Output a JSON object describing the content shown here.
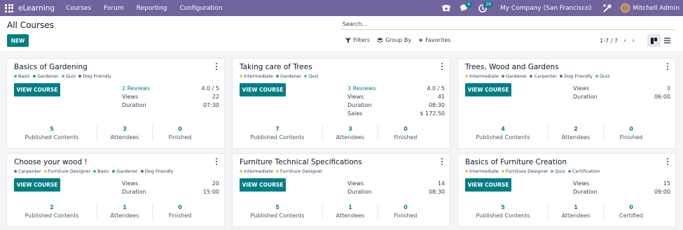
{
  "navbar": {
    "brand": "eLearning",
    "menu": [
      "Courses",
      "Forum",
      "Reporting",
      "Configuration"
    ],
    "messages_badge": "6",
    "activities_badge": "39",
    "company": "My Company (San Francisco)",
    "user": "Mitchell Admin",
    "colors": {
      "bar": "#71639e",
      "badge": "#017e84"
    }
  },
  "control": {
    "title": "All Courses",
    "new_label": "NEW",
    "search_placeholder": "Search...",
    "filters_label": "Filters",
    "groupby_label": "Group By",
    "favorites_label": "Favorites",
    "pager": "1-7 / 7"
  },
  "accent_color": "#017e84",
  "cards": [
    {
      "title": "Basics of Gardening",
      "tags": [
        {
          "name": "Basic",
          "color": "#3ebf6b"
        },
        {
          "name": "Gardener",
          "color": "#2e9e74"
        },
        {
          "name": "Quiz",
          "color": "#5fb7c8"
        },
        {
          "name": "Dog Friendly",
          "color": "#6f5b99"
        }
      ],
      "button": "VIEW COURSE",
      "stats": [
        {
          "label": "2 Reviews",
          "value": "4.0 / 5",
          "link": true
        },
        {
          "label": "Views",
          "value": "22"
        },
        {
          "label": "Duration",
          "value": "07:30"
        }
      ],
      "bottom": [
        {
          "num": "5",
          "label": "Published Contents"
        },
        {
          "num": "3",
          "label": "Attendees"
        },
        {
          "num": "0",
          "label": "Finished"
        }
      ]
    },
    {
      "title": "Taking care of Trees",
      "tags": [
        {
          "name": "Intermediate",
          "color": "#f0c42e"
        },
        {
          "name": "Gardener",
          "color": "#2e9e74"
        },
        {
          "name": "Quiz",
          "color": "#5fb7c8"
        }
      ],
      "button": "VIEW COURSE",
      "stats": [
        {
          "label": "3 Reviews",
          "value": "4.0 / 5",
          "link": true
        },
        {
          "label": "Views",
          "value": "41"
        },
        {
          "label": "Duration",
          "value": "08:30"
        },
        {
          "label": "Sales",
          "value": "$ 172.50"
        }
      ],
      "bottom": [
        {
          "num": "7",
          "label": "Published Contents"
        },
        {
          "num": "3",
          "label": "Attendees"
        },
        {
          "num": "0",
          "label": "Finished"
        }
      ]
    },
    {
      "title": "Trees, Wood and Gardens",
      "tags": [
        {
          "name": "Intermediate",
          "color": "#f0c42e"
        },
        {
          "name": "Gardener",
          "color": "#2e9e74"
        },
        {
          "name": "Carpenter",
          "color": "#8a62a8"
        },
        {
          "name": "Dog Friendly",
          "color": "#6f5b99"
        },
        {
          "name": "Quiz",
          "color": "#5fb7c8"
        }
      ],
      "button": "VIEW COURSE",
      "stats": [
        {
          "label": "Views",
          "value": "3"
        },
        {
          "label": "Duration",
          "value": "06:00"
        }
      ],
      "bottom": [
        {
          "num": "4",
          "label": "Published Contents"
        },
        {
          "num": "2",
          "label": "Attendees"
        },
        {
          "num": "0",
          "label": "Finished"
        }
      ]
    },
    {
      "title": "Choose your wood !",
      "tags": [
        {
          "name": "Carpenter",
          "color": "#8a62a8"
        },
        {
          "name": "Furniture Designer",
          "color": "#f0c42e"
        },
        {
          "name": "Basic",
          "color": "#3ebf6b"
        },
        {
          "name": "Gardener",
          "color": "#2e9e74"
        },
        {
          "name": "Dog Friendly",
          "color": "#6f5b99"
        }
      ],
      "button": "VIEW COURSE",
      "stats": [
        {
          "label": "Views",
          "value": "20"
        },
        {
          "label": "Duration",
          "value": "15:00"
        }
      ],
      "bottom": [
        {
          "num": "2",
          "label": "Published Contents"
        },
        {
          "num": "1",
          "label": "Attendees"
        },
        {
          "num": "0",
          "label": "Finished"
        }
      ]
    },
    {
      "title": "Furniture Technical Specifications",
      "tags": [
        {
          "name": "Intermediate",
          "color": "#f0c42e"
        },
        {
          "name": "Furniture Designer",
          "color": "#f0c42e"
        }
      ],
      "button": "VIEW COURSE",
      "stats": [
        {
          "label": "Views",
          "value": "14"
        },
        {
          "label": "Duration",
          "value": "08:30"
        }
      ],
      "bottom": [
        {
          "num": "5",
          "label": "Published Contents"
        },
        {
          "num": "1",
          "label": "Attendees"
        },
        {
          "num": "0",
          "label": "Finished"
        }
      ]
    },
    {
      "title": "Basics of Furniture Creation",
      "tags": [
        {
          "name": "Intermediate",
          "color": "#f0c42e"
        },
        {
          "name": "Furniture Designer",
          "color": "#f0c42e"
        },
        {
          "name": "Quiz",
          "color": "#5fb7c8"
        },
        {
          "name": "Certification",
          "color": "#4f8fd6"
        }
      ],
      "button": "VIEW COURSE",
      "stats": [
        {
          "label": "Views",
          "value": "15"
        },
        {
          "label": "Duration",
          "value": "09:00"
        }
      ],
      "bottom": [
        {
          "num": "5",
          "label": "Published Contents"
        },
        {
          "num": "1",
          "label": "Attendees"
        },
        {
          "num": "0",
          "label": "Certified"
        }
      ]
    }
  ]
}
